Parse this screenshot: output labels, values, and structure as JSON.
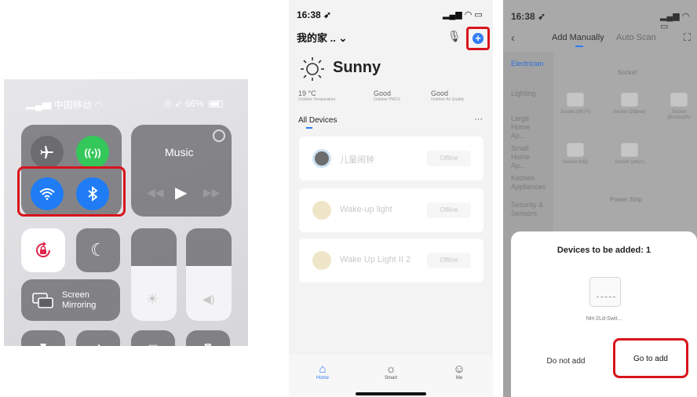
{
  "control_center": {
    "carrier": "中国移动",
    "battery_text": "66%",
    "music_label": "Music",
    "screen_mirroring_line1": "Screen",
    "screen_mirroring_line2": "Mirroring",
    "highlight_color": "#d8141b"
  },
  "app_home": {
    "status_time": "16:38",
    "home_title": "我的家 ..",
    "weather": "Sunny",
    "stats": [
      {
        "value": "19 °C",
        "label": "Outdoor Temperature"
      },
      {
        "value": "Good",
        "label": "Outdoor PM2.5"
      },
      {
        "value": "Good",
        "label": "Outdoor Air Quality"
      }
    ],
    "section_title": "All Devices",
    "more": "···",
    "devices": [
      {
        "name": "儿童闹钟",
        "status": "Offline"
      },
      {
        "name": "Wake-up light",
        "status": "Offline"
      },
      {
        "name": "Wake Up Light II 2",
        "status": "Offline"
      }
    ],
    "tabbar": {
      "home": "Home",
      "smart": "Smart",
      "me": "Me"
    },
    "accent_color": "#2f7cf6"
  },
  "add_device": {
    "status_time": "16:38",
    "tab_add_manually": "Add Manually",
    "tab_auto_scan": "Auto Scan",
    "categories": [
      "Electrician",
      "Lighting",
      "Large Home Ap...",
      "Small Home Ap...",
      "Kitchen Appliances",
      "Security & Sensors"
    ],
    "section_socket": "Socket",
    "section_power_strip": "Power Strip",
    "socket_items": [
      "Socket (Wi-Fi)",
      "Socket (Zigbee)",
      "Socket (Bluetooth)",
      "Socket (NB)",
      "Socket (other)"
    ],
    "sheet_title": "Devices to be added: 1",
    "device_name": "NH-2Ld-Swit...",
    "btn_cancel": "Do not add",
    "btn_confirm": "Go to add"
  }
}
